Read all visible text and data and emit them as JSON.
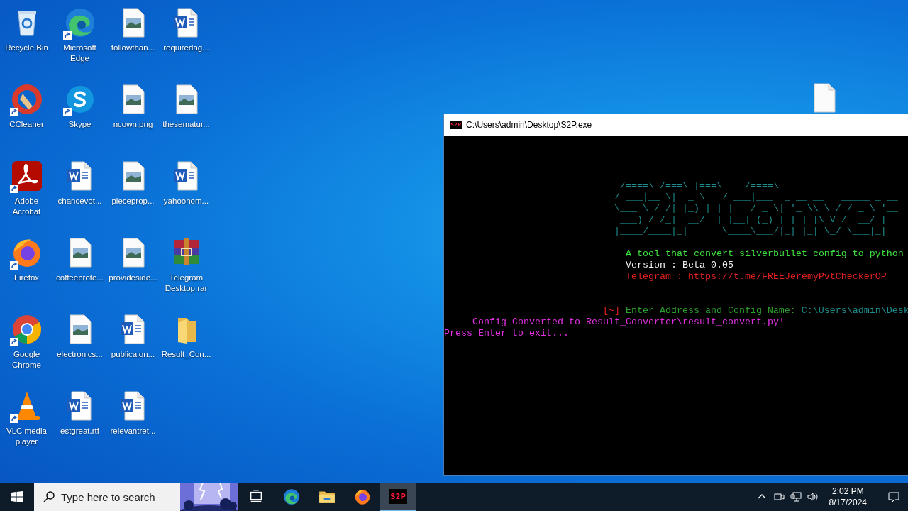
{
  "desktop": {
    "icons": [
      {
        "label": "Recycle Bin",
        "kind": "recycle-bin",
        "shortcut": false
      },
      {
        "label": "CCleaner",
        "kind": "ccleaner",
        "shortcut": true
      },
      {
        "label": "Adobe Acrobat",
        "kind": "acrobat",
        "shortcut": true
      },
      {
        "label": "Firefox",
        "kind": "firefox",
        "shortcut": true
      },
      {
        "label": "Google Chrome",
        "kind": "chrome",
        "shortcut": true
      },
      {
        "label": "VLC media player",
        "kind": "vlc",
        "shortcut": true
      },
      {
        "label": "Microsoft Edge",
        "kind": "edge",
        "shortcut": true
      },
      {
        "label": "Skype",
        "kind": "skype",
        "shortcut": true
      },
      {
        "label": "chancevot...",
        "kind": "word",
        "shortcut": false
      },
      {
        "label": "coffeeprote...",
        "kind": "image-file",
        "shortcut": false
      },
      {
        "label": "electronics...",
        "kind": "image-file",
        "shortcut": false
      },
      {
        "label": "estgreat.rtf",
        "kind": "word",
        "shortcut": false
      },
      {
        "label": "followthan...",
        "kind": "image-file",
        "shortcut": false
      },
      {
        "label": "ncown.png",
        "kind": "image-file",
        "shortcut": false
      },
      {
        "label": "pieceprop...",
        "kind": "image-file",
        "shortcut": false
      },
      {
        "label": "provideside...",
        "kind": "image-file",
        "shortcut": false
      },
      {
        "label": "publicalon...",
        "kind": "word",
        "shortcut": false
      },
      {
        "label": "relevantret...",
        "kind": "word",
        "shortcut": false
      },
      {
        "label": "requiredag...",
        "kind": "word",
        "shortcut": false
      },
      {
        "label": "thesematur...",
        "kind": "image-file",
        "shortcut": false
      },
      {
        "label": "yahoohom...",
        "kind": "word",
        "shortcut": false
      },
      {
        "label": "Telegram Desktop.rar",
        "kind": "archive",
        "shortcut": false
      },
      {
        "label": "Result_Con...",
        "kind": "folder",
        "shortcut": false
      }
    ],
    "partly_hidden_icons": [
      {
        "kind": "blank-file"
      }
    ]
  },
  "console_window": {
    "icon_text": "S2P",
    "title": "C:\\Users\\admin\\Desktop\\S2P.exe",
    "lines": [
      {
        "kind": "banner",
        "segments": [
          {
            "text": "  /====\\ /===\\ |===\\    /====\\",
            "color": "#1e8c8c"
          }
        ]
      },
      {
        "kind": "banner",
        "segments": [
          {
            "text": " / ___|__ \\|  _ \\   / ___|___  _ __ __   _____ _ __",
            "color": "#1e8c8c"
          }
        ]
      },
      {
        "kind": "banner",
        "segments": [
          {
            "text": " \\___ \\ / /| |_) | | |   / _ \\| '_ \\\\ \\ / / _ \\ '__",
            "color": "#1e8c8c"
          }
        ]
      },
      {
        "kind": "banner",
        "segments": [
          {
            "text": "  ___) / /_|  __/  | |__| (_) | | | |\\ V /  __/ |",
            "color": "#1e8c8c"
          }
        ]
      },
      {
        "kind": "banner",
        "segments": [
          {
            "text": " |____/____|_|      \\____\\___/|_| |_| \\_/ \\___|_|",
            "color": "#1e8c8c"
          }
        ]
      },
      {
        "kind": "info",
        "segments": [
          {
            "text": "A tool that convert silverbullet config to python",
            "color": "#3ee03e"
          }
        ]
      },
      {
        "kind": "info",
        "segments": [
          {
            "text": "Version : Beta 0.05",
            "color": "#f2f2f2"
          }
        ]
      },
      {
        "kind": "info",
        "segments": [
          {
            "text": "Telegram : https://t.me/FREEJeremyPvtCheckerOP",
            "color": "#e02020"
          }
        ]
      },
      {
        "kind": "prompt",
        "segments": [
          {
            "text": "[~]",
            "color": "#e02020"
          },
          {
            "text": "Enter Address and Config Name:",
            "color": "#2e9e2e"
          },
          {
            "text": "C:\\Users\\admin\\Desk",
            "color": "#1e8c8c"
          }
        ]
      },
      {
        "kind": "result",
        "segments": [
          {
            "text": "Config Converted to Result_Converter\\result_convert.py!",
            "color": "#e030e0"
          }
        ]
      },
      {
        "kind": "exit",
        "segments": [
          {
            "text": "Press Enter to exit...",
            "color": "#e030e0"
          }
        ]
      }
    ]
  },
  "taskbar": {
    "search": {
      "placeholder": "Type here to search"
    },
    "apps": [
      {
        "kind": "task-view",
        "selected": false
      },
      {
        "kind": "edge",
        "selected": false
      },
      {
        "kind": "explorer",
        "selected": false
      },
      {
        "kind": "firefox",
        "selected": false
      },
      {
        "kind": "s2p",
        "icon_text": "S2P",
        "selected": true
      }
    ],
    "tray": {
      "time": "2:02 PM",
      "date": "8/17/2024"
    }
  }
}
